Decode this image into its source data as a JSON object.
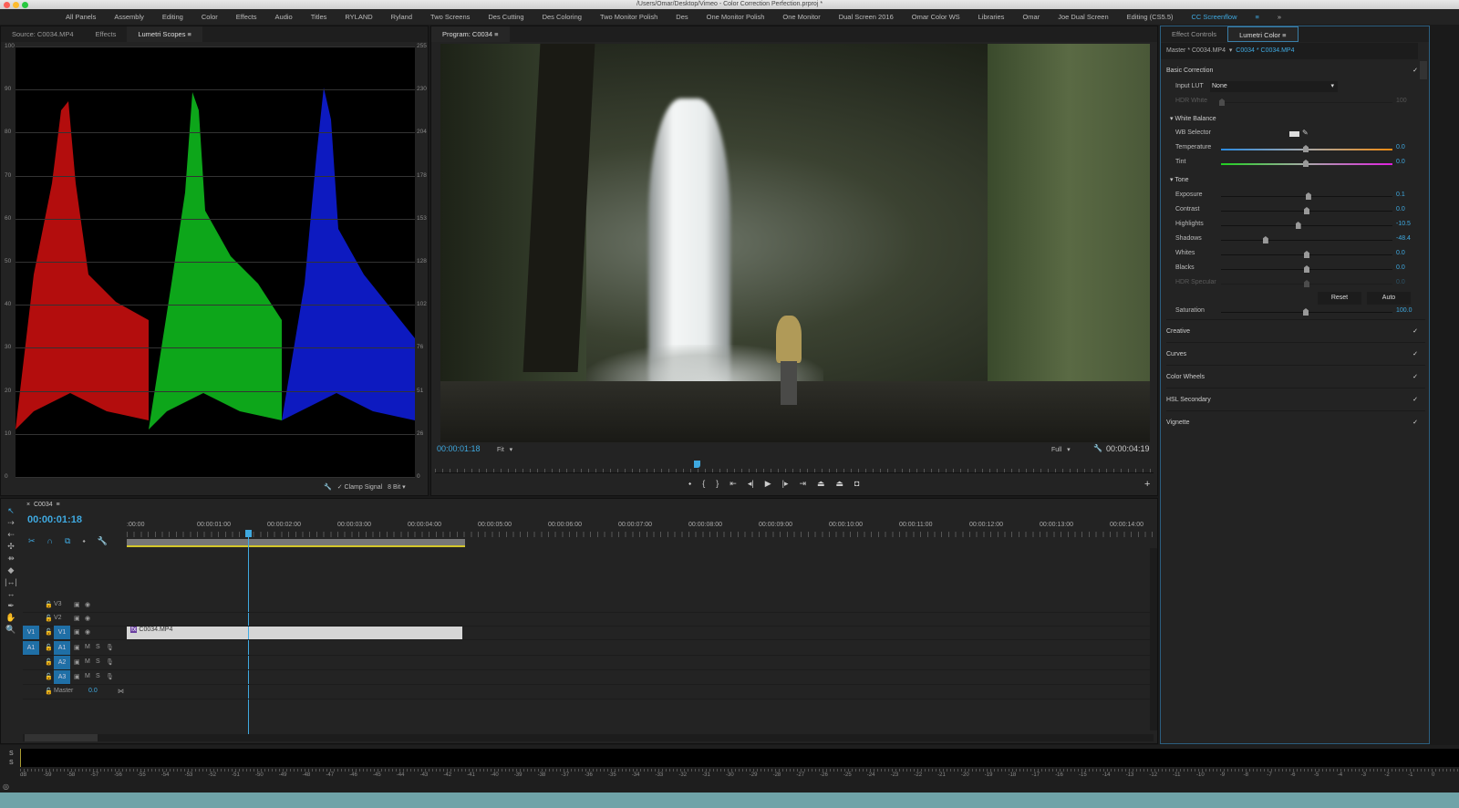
{
  "window": {
    "title": "/Users/Omar/Desktop/Vimeo - Color Correction Perfection.prproj *"
  },
  "workspaces": [
    "All Panels",
    "Assembly",
    "Editing",
    "Color",
    "Effects",
    "Audio",
    "Titles",
    "RYLAND",
    "Ryland",
    "Two Screens",
    "Des Cutting",
    "Des Coloring",
    "Two Monitor Polish",
    "Des",
    "One Monitor Polish",
    "One Monitor",
    "Dual Screen 2016",
    "Omar Color WS",
    "Libraries",
    "Omar",
    "Joe Dual Screen",
    "Editing (CS5.5)",
    "CC Screenflow"
  ],
  "workspace_active": "CC Screenflow",
  "workspace_more": "»",
  "source_panel": {
    "tabs": [
      "Source: C0034.MP4",
      "Effects",
      "Lumetri Scopes"
    ],
    "active_tab": "Lumetri Scopes",
    "scale_left": [
      "100",
      "90",
      "80",
      "70",
      "60",
      "50",
      "40",
      "30",
      "20",
      "10",
      "0"
    ],
    "scale_right": [
      "255",
      "230",
      "204",
      "178",
      "153",
      "128",
      "102",
      "76",
      "51",
      "26",
      "0"
    ],
    "clamp_signal": "Clamp Signal",
    "clamp_checked": true,
    "bit_depth": "8 Bit"
  },
  "program": {
    "tab": "Program: C0034",
    "timecode": "00:00:01:18",
    "zoom": "Fit",
    "resolution": "Full",
    "duration": "00:00:04:19",
    "playhead_fraction": 0.36
  },
  "lumetri": {
    "tabs": [
      "Effect Controls",
      "Lumetri Color"
    ],
    "active_tab": "Lumetri Color",
    "master_clip": "Master * C0034.MP4",
    "sequence_clip": "C0034 * C0034.MP4",
    "basic_correction": "Basic Correction",
    "input_lut_label": "Input LUT",
    "input_lut_value": "None",
    "hdr_white": {
      "label": "HDR White",
      "value": "100"
    },
    "white_balance": "White Balance",
    "wb_selector": "WB Selector",
    "temperature": {
      "label": "Temperature",
      "value": "0.0"
    },
    "tint": {
      "label": "Tint",
      "value": "0.0"
    },
    "tone": "Tone",
    "tone_sliders": [
      {
        "label": "Exposure",
        "value": "0.1",
        "pos": 0.51
      },
      {
        "label": "Contrast",
        "value": "0.0",
        "pos": 0.5
      },
      {
        "label": "Highlights",
        "value": "-10.5",
        "pos": 0.45
      },
      {
        "label": "Shadows",
        "value": "-48.4",
        "pos": 0.26
      },
      {
        "label": "Whites",
        "value": "0.0",
        "pos": 0.5
      },
      {
        "label": "Blacks",
        "value": "0.0",
        "pos": 0.5
      },
      {
        "label": "HDR Specular",
        "value": "0.0",
        "pos": 0.5
      }
    ],
    "reset": "Reset",
    "auto": "Auto",
    "saturation": {
      "label": "Saturation",
      "value": "100.0"
    },
    "sections": [
      "Creative",
      "Curves",
      "Color Wheels",
      "HSL Secondary",
      "Vignette"
    ]
  },
  "timeline": {
    "sequence": "C0034",
    "timecode": "00:00:01:18",
    "ruler": [
      ":00:00",
      "00:00:01:00",
      "00:00:02:00",
      "00:00:03:00",
      "00:00:04:00",
      "00:00:05:00",
      "00:00:06:00",
      "00:00:07:00",
      "00:00:08:00",
      "00:00:09:00",
      "00:00:10:00",
      "00:00:11:00",
      "00:00:12:00",
      "00:00:13:00",
      "00:00:14:00"
    ],
    "video_tracks": [
      "V3",
      "V2",
      "V1"
    ],
    "audio_tracks": [
      "A1",
      "A2",
      "A3"
    ],
    "source_v": "V1",
    "source_a": "A1",
    "mute": "M",
    "solo": "S",
    "master": "Master",
    "master_value": "0.0",
    "clip": "C0034.MP4"
  },
  "audio_meter": {
    "solo": [
      "S",
      "S"
    ],
    "scale": [
      "dB",
      "-59",
      "-58",
      "-57",
      "-56",
      "-55",
      "-54",
      "-53",
      "-52",
      "-51",
      "-50",
      "-49",
      "-48",
      "-47",
      "-46",
      "-45",
      "-44",
      "-43",
      "-42",
      "-41",
      "-40",
      "-39",
      "-38",
      "-37",
      "-36",
      "-35",
      "-34",
      "-33",
      "-32",
      "-31",
      "-30",
      "-29",
      "-28",
      "-27",
      "-26",
      "-25",
      "-24",
      "-23",
      "-22",
      "-21",
      "-20",
      "-19",
      "-18",
      "-17",
      "-16",
      "-15",
      "-14",
      "-13",
      "-12",
      "-11",
      "-10",
      "-9",
      "-8",
      "-7",
      "-6",
      "-5",
      "-4",
      "-3",
      "-2",
      "-1",
      "0"
    ]
  }
}
